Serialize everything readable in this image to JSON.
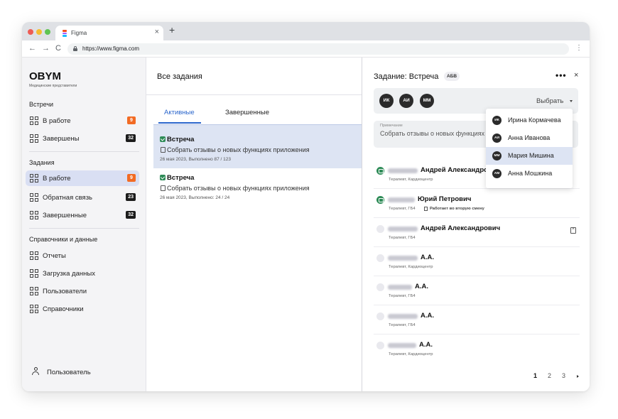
{
  "browser": {
    "tab_title": "Figma",
    "close_glyph": "×",
    "new_tab_glyph": "+",
    "back_glyph": "←",
    "forward_glyph": "→",
    "reload_glyph": "C",
    "url": "https://www.figma.com",
    "menu_glyph": "⋮",
    "traffic_lights": [
      "#ee5c54",
      "#f5bd31",
      "#5fc453"
    ]
  },
  "sidebar": {
    "logo": "OBYM",
    "logo_sub": "Медицинские представители",
    "sections": {
      "meetings": "Встречи",
      "tasks": "Задания",
      "references": "Справочники и данные"
    },
    "meetings_items": [
      {
        "label": "В работе",
        "badge": "9",
        "badge_color": "orange"
      },
      {
        "label": "Завершены",
        "badge": "32",
        "badge_color": "black"
      }
    ],
    "tasks_items": [
      {
        "label": "В работе",
        "badge": "9",
        "badge_color": "orange",
        "active": true
      },
      {
        "label": "Обратная связь",
        "badge": "23",
        "badge_color": "black"
      },
      {
        "label": "Завершенные",
        "badge": "32",
        "badge_color": "black"
      }
    ],
    "reference_items": [
      {
        "label": "Отчеты"
      },
      {
        "label": "Загрузка данных"
      },
      {
        "label": "Пользователи"
      },
      {
        "label": "Справочники"
      }
    ],
    "user_label": "Пользователь"
  },
  "middle": {
    "title": "Все задания",
    "tabs": [
      "Активные",
      "Завершенные"
    ],
    "active_tab": "Активные",
    "tasks": [
      {
        "title": "Встреча",
        "description": "Собрать отзывы о новых функциях приложения",
        "meta": "26 мая 2023, Выполнено 87 / 123",
        "selected": true
      },
      {
        "title": "Встреча",
        "description": "Собрать отзывы о новых функциях приложения",
        "meta": "26 мая 2023, Выполнено: 24 / 24",
        "selected": false
      }
    ]
  },
  "detail": {
    "title": "Задание: Встреча",
    "tag": "АБВ",
    "more_glyph": "•••",
    "close_glyph": "×",
    "assignees": [
      "ИК",
      "АИ",
      "ММ"
    ],
    "select_label": "Выбрать",
    "note_label": "Примечание",
    "note_text": "Собрать отзывы о новых функциях приложения",
    "participants": [
      {
        "name": "Андрей Александрович",
        "meta": "Терапевт, Кардиоцентр",
        "status": "done"
      },
      {
        "name": "Юрий Петрович",
        "meta": "Терапевт, ГБ4",
        "note": "Работает во вторую смену",
        "status": "done"
      },
      {
        "name": "Андрей Александрович",
        "meta": "Терапевт, ГБ4",
        "status": "pending",
        "has_action": true
      },
      {
        "name": "А.А.",
        "meta": "Терапевт, Кардиоцентр",
        "status": "pending"
      },
      {
        "name": "А.А.",
        "meta": "Терапевт, ГБ4",
        "status": "pending"
      },
      {
        "name": "А.А.",
        "meta": "Терапевт, ГБ4",
        "status": "pending"
      },
      {
        "name": "А.А.",
        "meta": "Терапевт, Кардиоцентр",
        "status": "pending"
      }
    ],
    "pagination": {
      "pages": [
        "1",
        "2",
        "3"
      ],
      "current": "1"
    }
  },
  "dropdown": {
    "options": [
      {
        "initials": "ИК",
        "name": "Ирина Кормачева"
      },
      {
        "initials": "АИ",
        "name": "Анна Иванова"
      },
      {
        "initials": "ММ",
        "name": "Мария Мишина",
        "highlighted": true
      },
      {
        "initials": "АМ",
        "name": "Анна Мошкина"
      }
    ]
  },
  "colors": {
    "accent": "#2b66cc",
    "badge_orange": "#f26b24",
    "success": "#2e8b57",
    "selection": "#d9dff3"
  },
  "icons": [
    "figma-icon",
    "lock-icon",
    "grid-icon",
    "user-icon",
    "check-icon",
    "document-icon",
    "remove-icon"
  ]
}
